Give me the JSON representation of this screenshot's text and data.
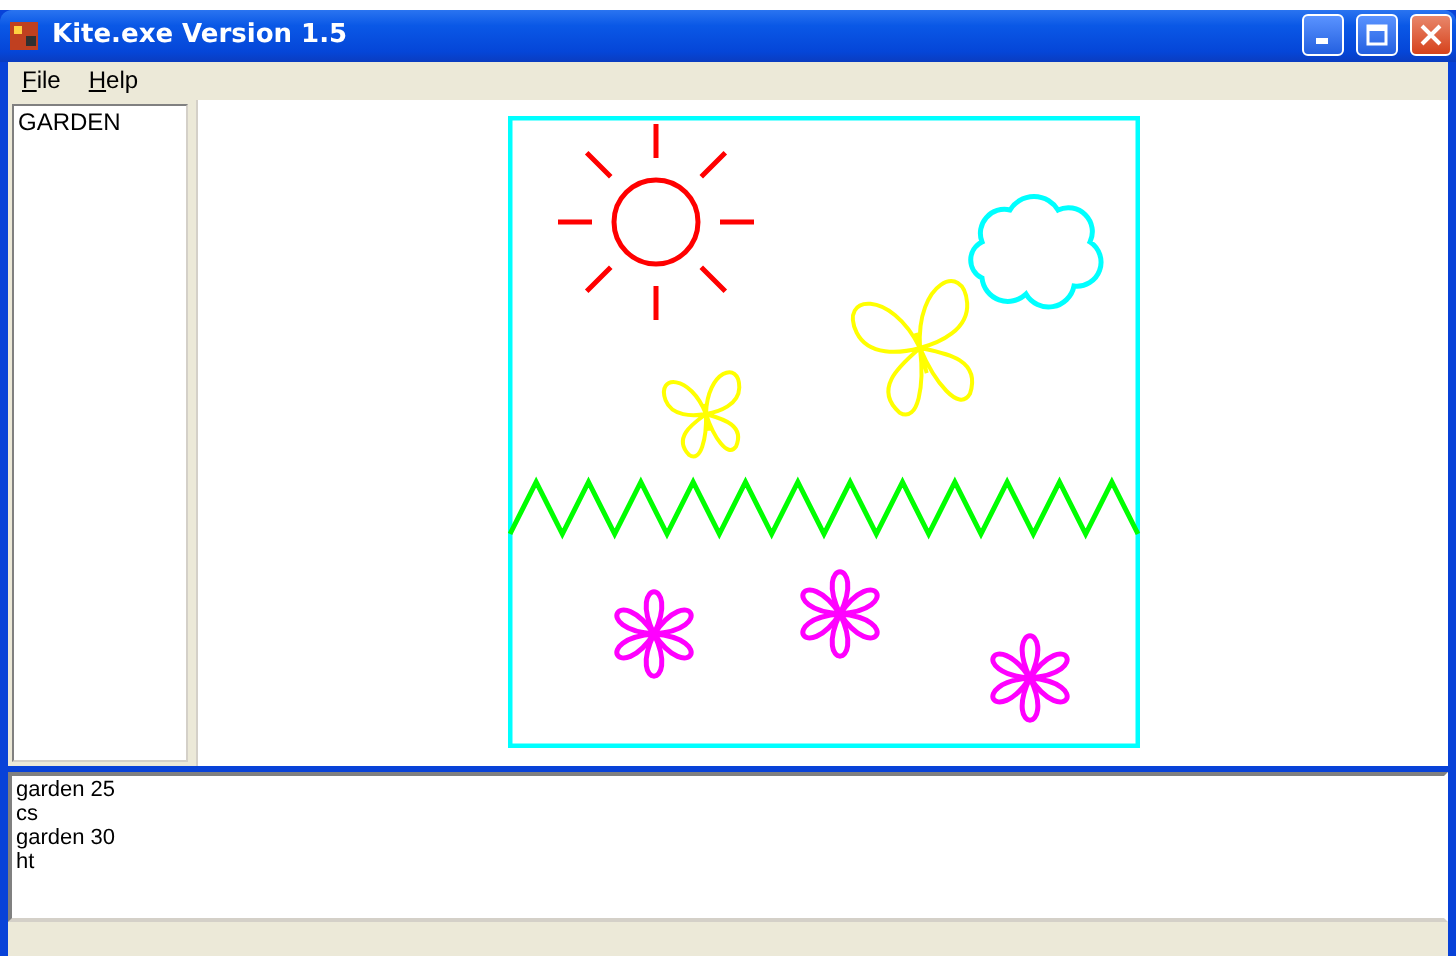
{
  "window": {
    "title": "Kite.exe Version 1.5"
  },
  "menu": [
    "File",
    "Help"
  ],
  "procedures": [
    {
      "label": "GARDEN",
      "selected": false
    }
  ],
  "console": {
    "lines": [
      "garden 25",
      "cs",
      "garden 30",
      "ht"
    ]
  }
}
